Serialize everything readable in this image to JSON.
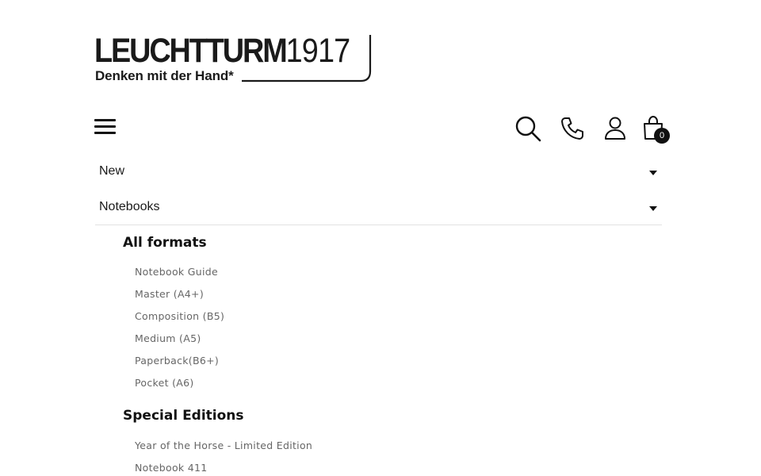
{
  "brand": {
    "name": "LEUCHTTURM",
    "number": "1917",
    "tagline": "Denken mit der Hand*"
  },
  "header": {
    "icons": [
      "menu-icon",
      "search-icon",
      "phone-icon",
      "account-icon",
      "cart-icon"
    ],
    "cart_count": "0"
  },
  "nav": {
    "items": [
      {
        "label": "New",
        "expanded": false
      },
      {
        "label": "Notebooks",
        "expanded": true
      }
    ]
  },
  "submenu": {
    "groups": [
      {
        "heading": "All formats",
        "links": [
          "Notebook Guide",
          "Master (A4+)",
          "Composition (B5)",
          "Medium (A5)",
          "Paperback(B6+)",
          "Pocket (A6)"
        ]
      },
      {
        "heading": "Special Editions",
        "links": [
          "Year of the Horse - Limited Edition",
          "Notebook 411"
        ]
      }
    ]
  },
  "colors": {
    "text": "#111111",
    "link": "#666666",
    "divider": "#e2e2e2",
    "badge": "#111111"
  }
}
